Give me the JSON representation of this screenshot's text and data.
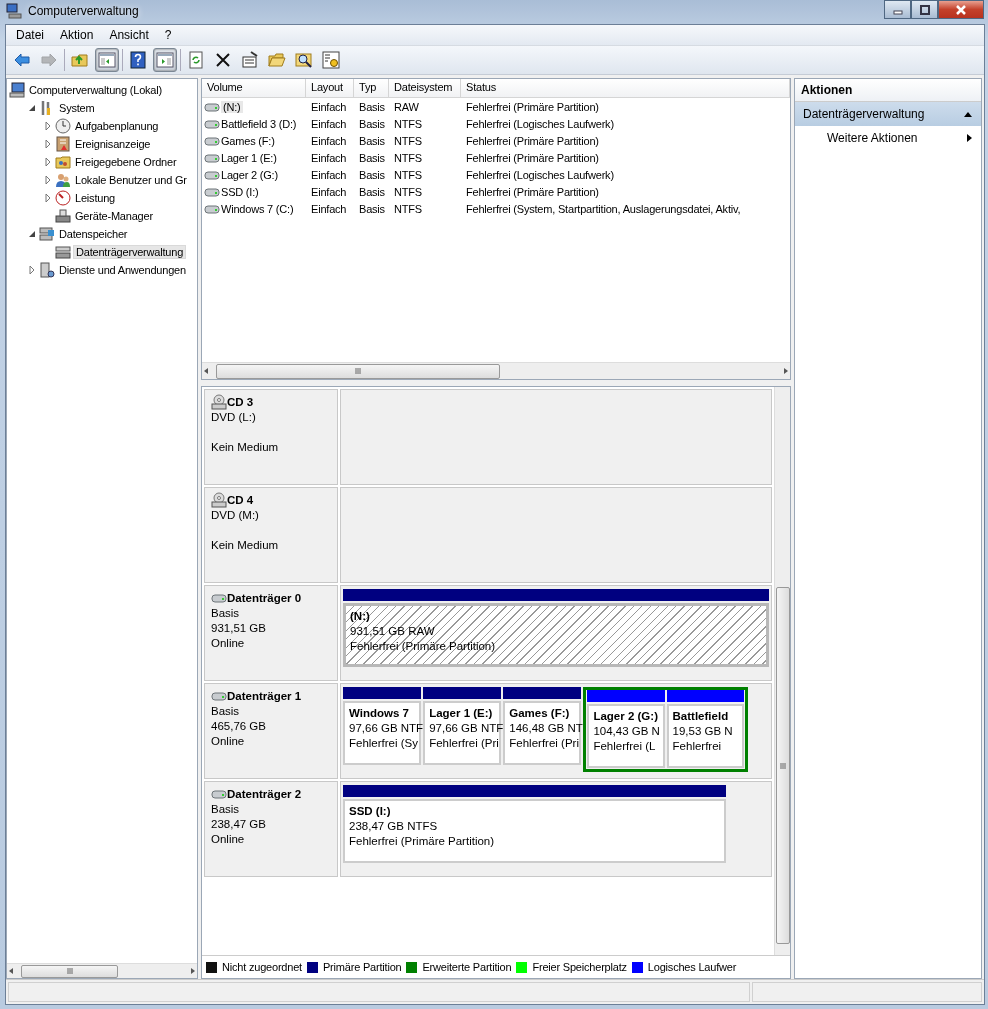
{
  "window": {
    "title": "Computerverwaltung"
  },
  "menu": [
    "Datei",
    "Aktion",
    "Ansicht",
    "?"
  ],
  "toolbar": [
    {
      "disabled": false,
      "pressed": false
    },
    {
      "disabled": true,
      "pressed": false
    },
    {
      "disabled": false,
      "pressed": false
    },
    {
      "disabled": false,
      "pressed": true
    },
    {
      "disabled": false,
      "pressed": false
    },
    {
      "disabled": false,
      "pressed": true
    },
    {
      "disabled": false,
      "pressed": false
    },
    {
      "disabled": false,
      "pressed": false
    },
    {
      "disabled": false,
      "pressed": false
    },
    {
      "disabled": false,
      "pressed": false
    },
    {
      "disabled": false,
      "pressed": false
    },
    {
      "disabled": false,
      "pressed": false
    }
  ],
  "tree": {
    "items": [
      {
        "label": "Computerverwaltung (Lokal)",
        "selected": false,
        "children": [
          {
            "label": "System",
            "selected": false,
            "expanded": true,
            "children": [
              {
                "label": "Aufgabenplanung",
                "selected": false,
                "expanded": false
              },
              {
                "label": "Ereignisanzeige",
                "selected": false,
                "expanded": false
              },
              {
                "label": "Freigegebene Ordner",
                "selected": false,
                "expanded": false
              },
              {
                "label": "Lokale Benutzer und Gr",
                "selected": false,
                "expanded": false
              },
              {
                "label": "Leistung",
                "selected": false,
                "expanded": false
              },
              {
                "label": "Geräte-Manager",
                "selected": false
              }
            ]
          },
          {
            "label": "Datenspeicher",
            "selected": false,
            "expanded": true,
            "children": [
              {
                "label": "Datenträgerverwaltung",
                "selected": true
              }
            ]
          },
          {
            "label": "Dienste und Anwendungen",
            "selected": false,
            "expanded": false
          }
        ]
      }
    ]
  },
  "volumes": {
    "columns": [
      "Volume",
      "Layout",
      "Typ",
      "Dateisystem",
      "Status"
    ],
    "rows": [
      {
        "selected": true,
        "cells": [
          "(N:)",
          "Einfach",
          "Basis",
          "RAW",
          "Fehlerfrei (Primäre Partition)"
        ]
      },
      {
        "selected": false,
        "cells": [
          "Battlefield 3 (D:)",
          "Einfach",
          "Basis",
          "NTFS",
          "Fehlerfrei (Logisches Laufwerk)"
        ]
      },
      {
        "selected": false,
        "cells": [
          "Games (F:)",
          "Einfach",
          "Basis",
          "NTFS",
          "Fehlerfrei (Primäre Partition)"
        ]
      },
      {
        "selected": false,
        "cells": [
          "Lager 1 (E:)",
          "Einfach",
          "Basis",
          "NTFS",
          "Fehlerfrei (Primäre Partition)"
        ]
      },
      {
        "selected": false,
        "cells": [
          "Lager 2 (G:)",
          "Einfach",
          "Basis",
          "NTFS",
          "Fehlerfrei (Logisches Laufwerk)"
        ]
      },
      {
        "selected": false,
        "cells": [
          "SSD (I:)",
          "Einfach",
          "Basis",
          "NTFS",
          "Fehlerfrei (Primäre Partition)"
        ]
      },
      {
        "selected": false,
        "cells": [
          "Windows 7 (C:)",
          "Einfach",
          "Basis",
          "NTFS",
          "Fehlerfrei (System, Startpartition, Auslagerungsdatei, Aktiv,"
        ]
      }
    ]
  },
  "disks": [
    {
      "kind": "cdrom",
      "name": "CD 3",
      "type": "DVD (L:)",
      "media": "Kein Medium"
    },
    {
      "kind": "cdrom",
      "name": "CD 4",
      "type": "DVD (M:)",
      "media": "Kein Medium"
    },
    {
      "kind": "disk",
      "name": "Datenträger 0",
      "type": "Basis",
      "size": "931,51 GB",
      "status": "Online",
      "partitions": [
        {
          "kind": "primary",
          "selected": true,
          "label": "(N:)",
          "size": "931,51 GB RAW",
          "status": "Fehlerfrei (Primäre Partition)"
        }
      ]
    },
    {
      "kind": "disk",
      "name": "Datenträger 1",
      "type": "Basis",
      "size": "465,76 GB",
      "status": "Online",
      "partitions": [
        {
          "kind": "primary",
          "selected": false,
          "label": "Windows 7",
          "size": "97,66 GB NTF",
          "status": "Fehlerfrei (Sy"
        },
        {
          "kind": "primary",
          "selected": false,
          "label": "Lager 1  (E:)",
          "size": "97,66 GB NTF",
          "status": "Fehlerfrei (Pri"
        },
        {
          "kind": "primary",
          "selected": false,
          "label": "Games  (F:)",
          "size": "146,48 GB NT",
          "status": "Fehlerfrei (Pri"
        },
        {
          "kind": "extended",
          "children": [
            {
              "kind": "logical",
              "selected": false,
              "label": "Lager 2  (G:)",
              "size": "104,43 GB N",
              "status": "Fehlerfrei (L"
            },
            {
              "kind": "logical",
              "selected": false,
              "label": "Battlefield",
              "size": "19,53 GB N",
              "status": "Fehlerfrei"
            }
          ]
        }
      ]
    },
    {
      "kind": "disk",
      "name": "Datenträger 2",
      "type": "Basis",
      "size": "238,47 GB",
      "status": "Online",
      "partitions": [
        {
          "kind": "primary",
          "selected": false,
          "label": "SSD  (I:)",
          "size": "238,47 GB NTFS",
          "status": "Fehlerfrei (Primäre Partition)"
        }
      ]
    }
  ],
  "legend": [
    {
      "label": "Nicht zugeordnet",
      "color": "#111111"
    },
    {
      "label": "Primäre Partition",
      "color": "#000080"
    },
    {
      "label": "Erweiterte Partition",
      "color": "#008000"
    },
    {
      "label": "Freier Speicherplatz",
      "color": "#00ff00"
    },
    {
      "label": "Logisches Laufwer",
      "color": "#0000ff"
    }
  ],
  "actions": {
    "title": "Aktionen",
    "sections": [
      {
        "label": "Datenträgerverwaltung",
        "expanded": true,
        "items": [
          "Weitere Aktionen"
        ]
      }
    ]
  }
}
